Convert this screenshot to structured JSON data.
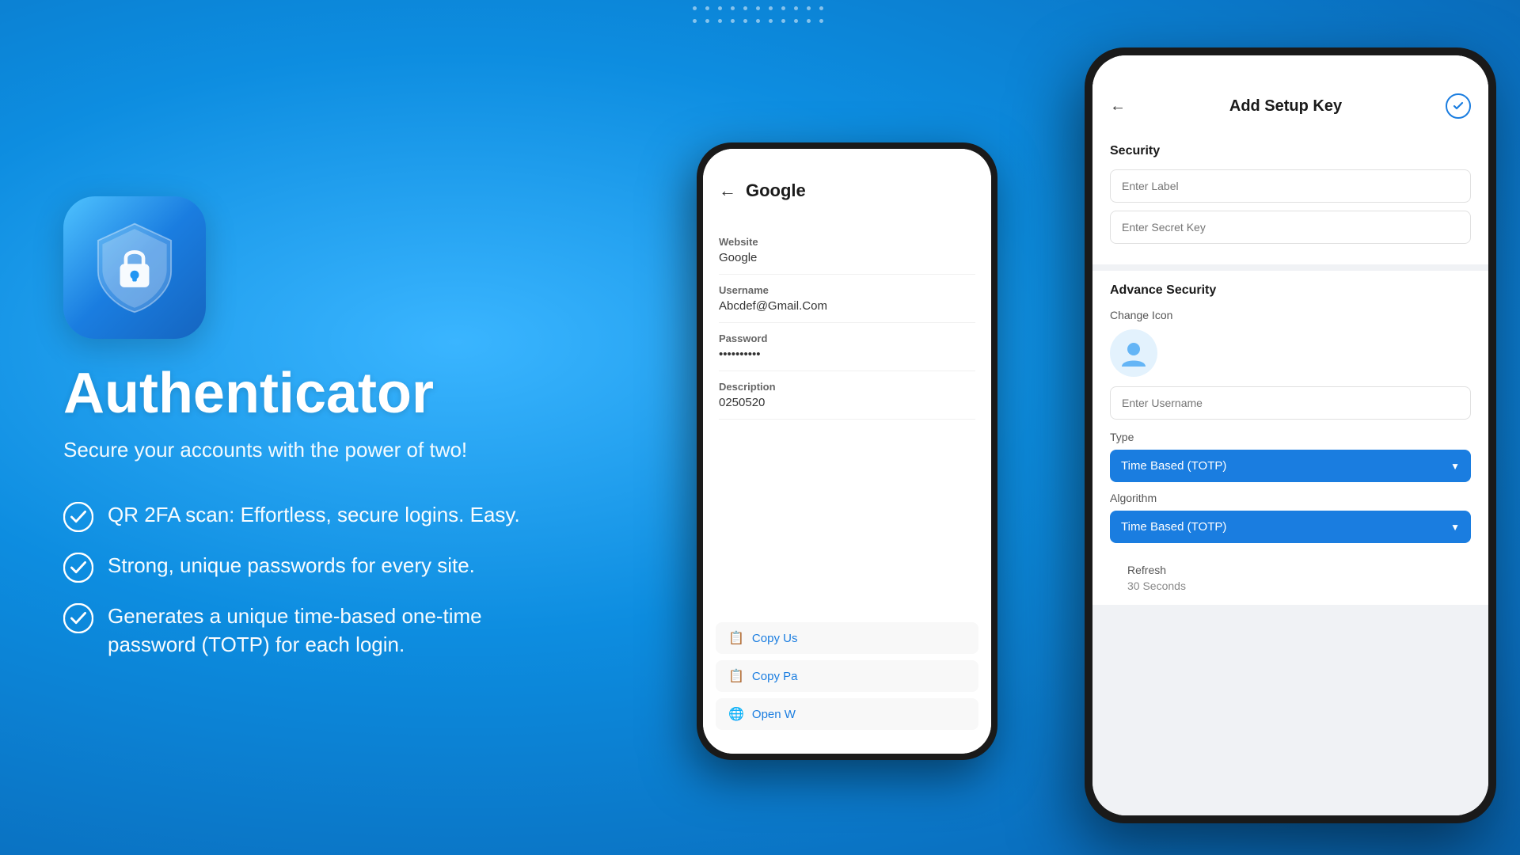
{
  "background": {
    "color": "#1a9ef5"
  },
  "dot_grid": {
    "cols": 11,
    "rows": 2
  },
  "left": {
    "app_title": "Authenticator",
    "app_subtitle": "Secure your accounts with the power of two!",
    "features": [
      {
        "id": "feature-qr",
        "text": "QR 2FA scan: Effortless, secure logins. Easy."
      },
      {
        "id": "feature-password",
        "text": "Strong, unique passwords for every site."
      },
      {
        "id": "feature-totp",
        "text": "Generates a unique time-based one-time password (TOTP) for each login."
      }
    ]
  },
  "phone_back": {
    "title": "Google",
    "details": [
      {
        "label": "Website",
        "value": "Google"
      },
      {
        "label": "Username",
        "value": "Abcdef@Gmail.Com"
      },
      {
        "label": "Password",
        "value": "••••••••••"
      },
      {
        "label": "Description",
        "value": "0250520"
      }
    ],
    "actions": [
      {
        "label": "Copy Us",
        "icon": "📋"
      },
      {
        "label": "Copy Pa",
        "icon": "📋"
      },
      {
        "label": "Open W",
        "icon": "🌐"
      }
    ]
  },
  "phone_front": {
    "title": "Add Setup Key",
    "security_section": {
      "title": "Security",
      "label_placeholder": "Enter Label",
      "secret_placeholder": "Enter Secret Key"
    },
    "advance_section": {
      "title": "Advance Security",
      "change_icon_label": "Change Icon",
      "enter_username_placeholder": "Enter Username",
      "type": {
        "label": "Type",
        "selected": "Time Based (TOTP)"
      },
      "algorithm": {
        "label": "Algorithm",
        "selected": "Time Based (TOTP)"
      },
      "refresh": {
        "label": "Refresh",
        "value": "30 Seconds"
      }
    }
  }
}
